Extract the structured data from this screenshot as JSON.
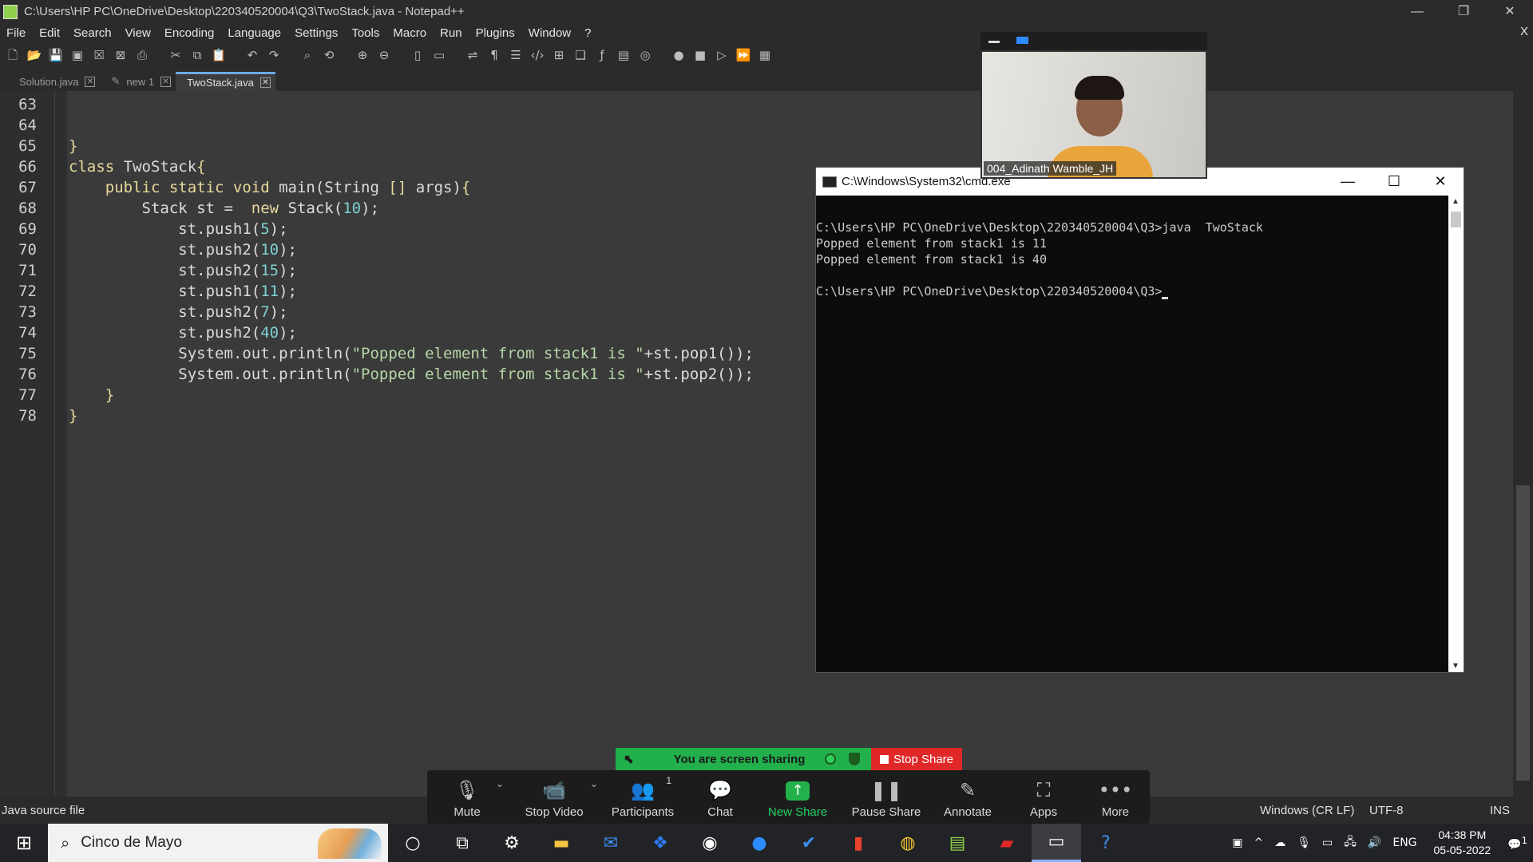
{
  "notepad": {
    "title": "C:\\Users\\HP PC\\OneDrive\\Desktop\\220340520004\\Q3\\TwoStack.java - Notepad++",
    "menu": [
      "File",
      "Edit",
      "Search",
      "View",
      "Encoding",
      "Language",
      "Settings",
      "Tools",
      "Macro",
      "Run",
      "Plugins",
      "Window",
      "?"
    ],
    "menu_close": "X",
    "tabs": [
      {
        "label": "Solution.java",
        "active": false
      },
      {
        "label": "new 1",
        "active": false
      },
      {
        "label": "TwoStack.java",
        "active": true
      }
    ],
    "line_numbers": [
      "63",
      "64",
      "65",
      "66",
      "67",
      "68",
      "69",
      "70",
      "71",
      "72",
      "73",
      "74",
      "75",
      "76",
      "77",
      "78"
    ],
    "status": {
      "file_type": "Java source file",
      "eol": "Windows (CR LF)",
      "encoding": "UTF-8",
      "mode": "INS"
    }
  },
  "cmd": {
    "title": "C:\\Windows\\System32\\cmd.exe",
    "lines": [
      "C:\\Users\\HP PC\\OneDrive\\Desktop\\220340520004\\Q3>java  TwoStack",
      "Popped element from stack1 is 11",
      "Popped element from stack1 is 40",
      "",
      "C:\\Users\\HP PC\\OneDrive\\Desktop\\220340520004\\Q3>"
    ]
  },
  "zoom": {
    "participant_name": "004_Adinath Wamble_JH",
    "sharing_text": "You are screen sharing",
    "stop_share": "Stop Share",
    "controls": [
      {
        "label": "Mute",
        "icon": "microphone-icon"
      },
      {
        "label": "Stop Video",
        "icon": "video-camera-icon"
      },
      {
        "label": "Participants",
        "icon": "participants-icon",
        "count": "1"
      },
      {
        "label": "Chat",
        "icon": "chat-icon"
      },
      {
        "label": "New Share",
        "icon": "share-arrow-icon"
      },
      {
        "label": "Pause Share",
        "icon": "pause-icon"
      },
      {
        "label": "Annotate",
        "icon": "pencil-icon"
      },
      {
        "label": "Apps",
        "icon": "apps-icon"
      },
      {
        "label": "More",
        "icon": "more-dots-icon"
      }
    ],
    "accent_green": "#23b14c",
    "accent_red": "#e02828"
  },
  "taskbar": {
    "search_text": "Cinco de Mayo",
    "language": "ENG",
    "time": "04:38 PM",
    "date": "05-05-2022",
    "notification_count": "1"
  }
}
